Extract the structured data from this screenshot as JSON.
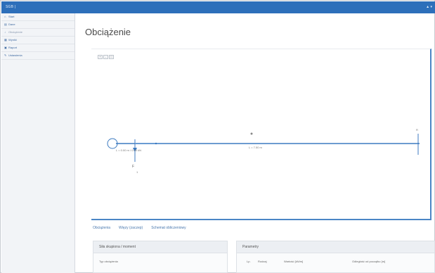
{
  "app": {
    "brand": "SGB | ",
    "topright": "▲ ▾"
  },
  "sidebar": {
    "items": [
      {
        "label": "Start",
        "icon": "home-icon",
        "glyph": "⌂",
        "active": false
      },
      {
        "label": "Dane",
        "icon": "data-icon",
        "glyph": "▤",
        "active": false
      },
      {
        "label": "Obciążenie",
        "icon": "load-icon",
        "glyph": "↓",
        "active": true
      },
      {
        "label": "Wyniki",
        "icon": "chart-icon",
        "glyph": "▦",
        "active": false
      },
      {
        "label": "Raport",
        "icon": "report-icon",
        "glyph": "▣",
        "active": false
      },
      {
        "label": "Ustawienia",
        "icon": "settings-icon",
        "glyph": "✎",
        "active": false
      }
    ]
  },
  "page": {
    "title": "Obciążenie"
  },
  "diagram": {
    "zoom_buttons": [
      "+",
      "-",
      "□"
    ],
    "label_left_support": "L = 0.00 m / 0.00 kN",
    "label_mid": "L = 7.50 m",
    "label_force": "F",
    "label_force_value": "1",
    "label_end": "R"
  },
  "tabs": [
    "Obciążenia",
    "Więzy (zaczep)",
    "Schemat obliczeniowy"
  ],
  "left_panel": {
    "title": "Siła skupiona / moment",
    "row": "Typ obciążenia"
  },
  "right_panel": {
    "title": "Parametry",
    "columns": [
      "Lp.",
      "Rodzaj",
      "Wartość [kN/m]",
      "Odległość od początku [m]"
    ]
  }
}
